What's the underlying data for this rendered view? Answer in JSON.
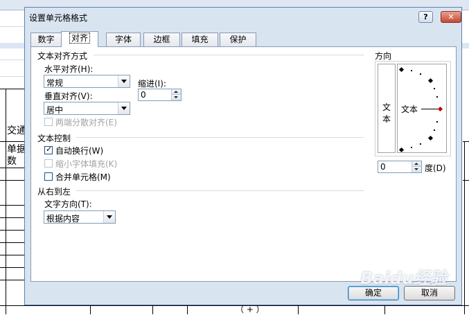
{
  "dialog": {
    "title": "设置单元格格式",
    "help_label": "?",
    "close_label": "✕",
    "tabs": [
      "数字",
      "对齐",
      "字体",
      "边框",
      "填充",
      "保护"
    ],
    "active_tab": "对齐",
    "ok_label": "确定",
    "cancel_label": "取消"
  },
  "alignment": {
    "section_title": "文本对齐方式",
    "horizontal_label": "水平对齐(H):",
    "horizontal_value": "常规",
    "indent_label": "缩进(I):",
    "indent_value": "0",
    "vertical_label": "垂直对齐(V):",
    "vertical_value": "居中",
    "distributed_label": "两端分散对齐(E)"
  },
  "text_control": {
    "section_title": "文本控制",
    "wrap_label": "自动换行(W)",
    "wrap_checked": true,
    "shrink_label": "缩小字体填充(K)",
    "merge_label": "合并单元格(M)"
  },
  "rtl": {
    "section_title": "从右到左",
    "direction_label": "文字方向(T):",
    "direction_value": "根据内容"
  },
  "orientation": {
    "section_title": "方向",
    "vertical_text_1": "文",
    "vertical_text_2": "本",
    "horizontal_text": "文本",
    "degrees_value": "0",
    "degrees_label": "度(D)",
    "pointer_color": "#c00000"
  },
  "background": {
    "cell_1": "交通",
    "cell_2": "单据",
    "cell_3": "数",
    "cell_4": "（ + ）"
  },
  "watermark": "Baidu经验"
}
